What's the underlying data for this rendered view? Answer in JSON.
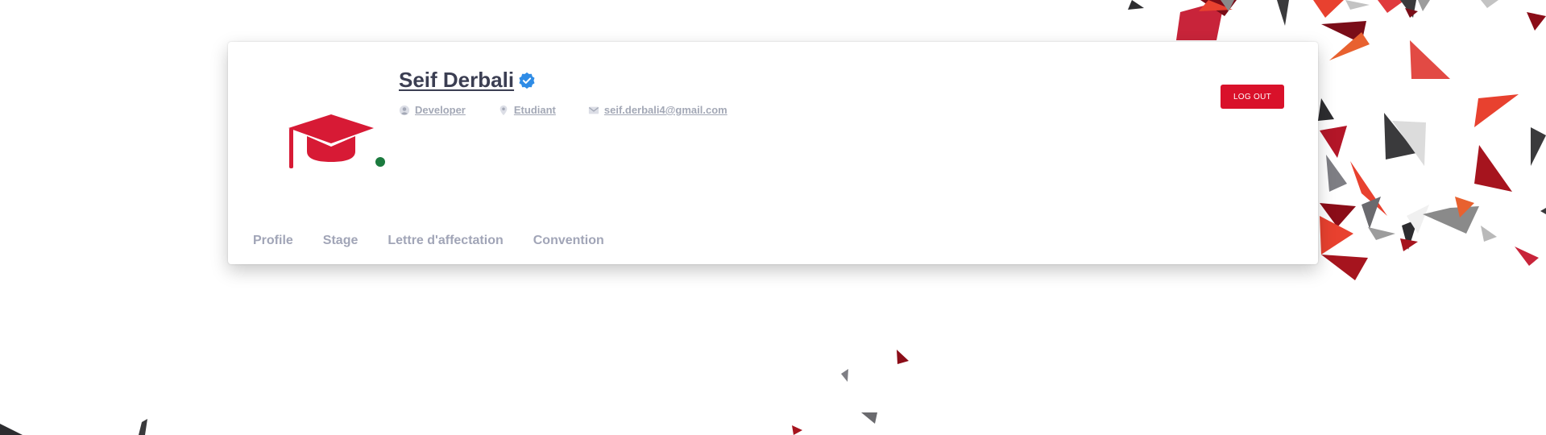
{
  "profile": {
    "name": "Seif Derbali",
    "online_color": "#1b7a3e",
    "meta": [
      {
        "icon": "user-circle-icon",
        "label": "Developer"
      },
      {
        "icon": "location-pin-icon",
        "label": "Etudiant"
      },
      {
        "icon": "envelope-icon",
        "label": "seif.derbali4@gmail.com"
      }
    ]
  },
  "actions": {
    "logout_label": "Log out"
  },
  "tabs": [
    {
      "label": "Profile"
    },
    {
      "label": "Stage"
    },
    {
      "label": "Lettre d'affectation"
    },
    {
      "label": "Convention"
    }
  ],
  "colors": {
    "accent": "#d9112a",
    "avatar_red": "#d71a35",
    "verified_blue": "#2f8ce6",
    "tab_text": "#a1a5b7",
    "name_text": "#3b3e52"
  }
}
